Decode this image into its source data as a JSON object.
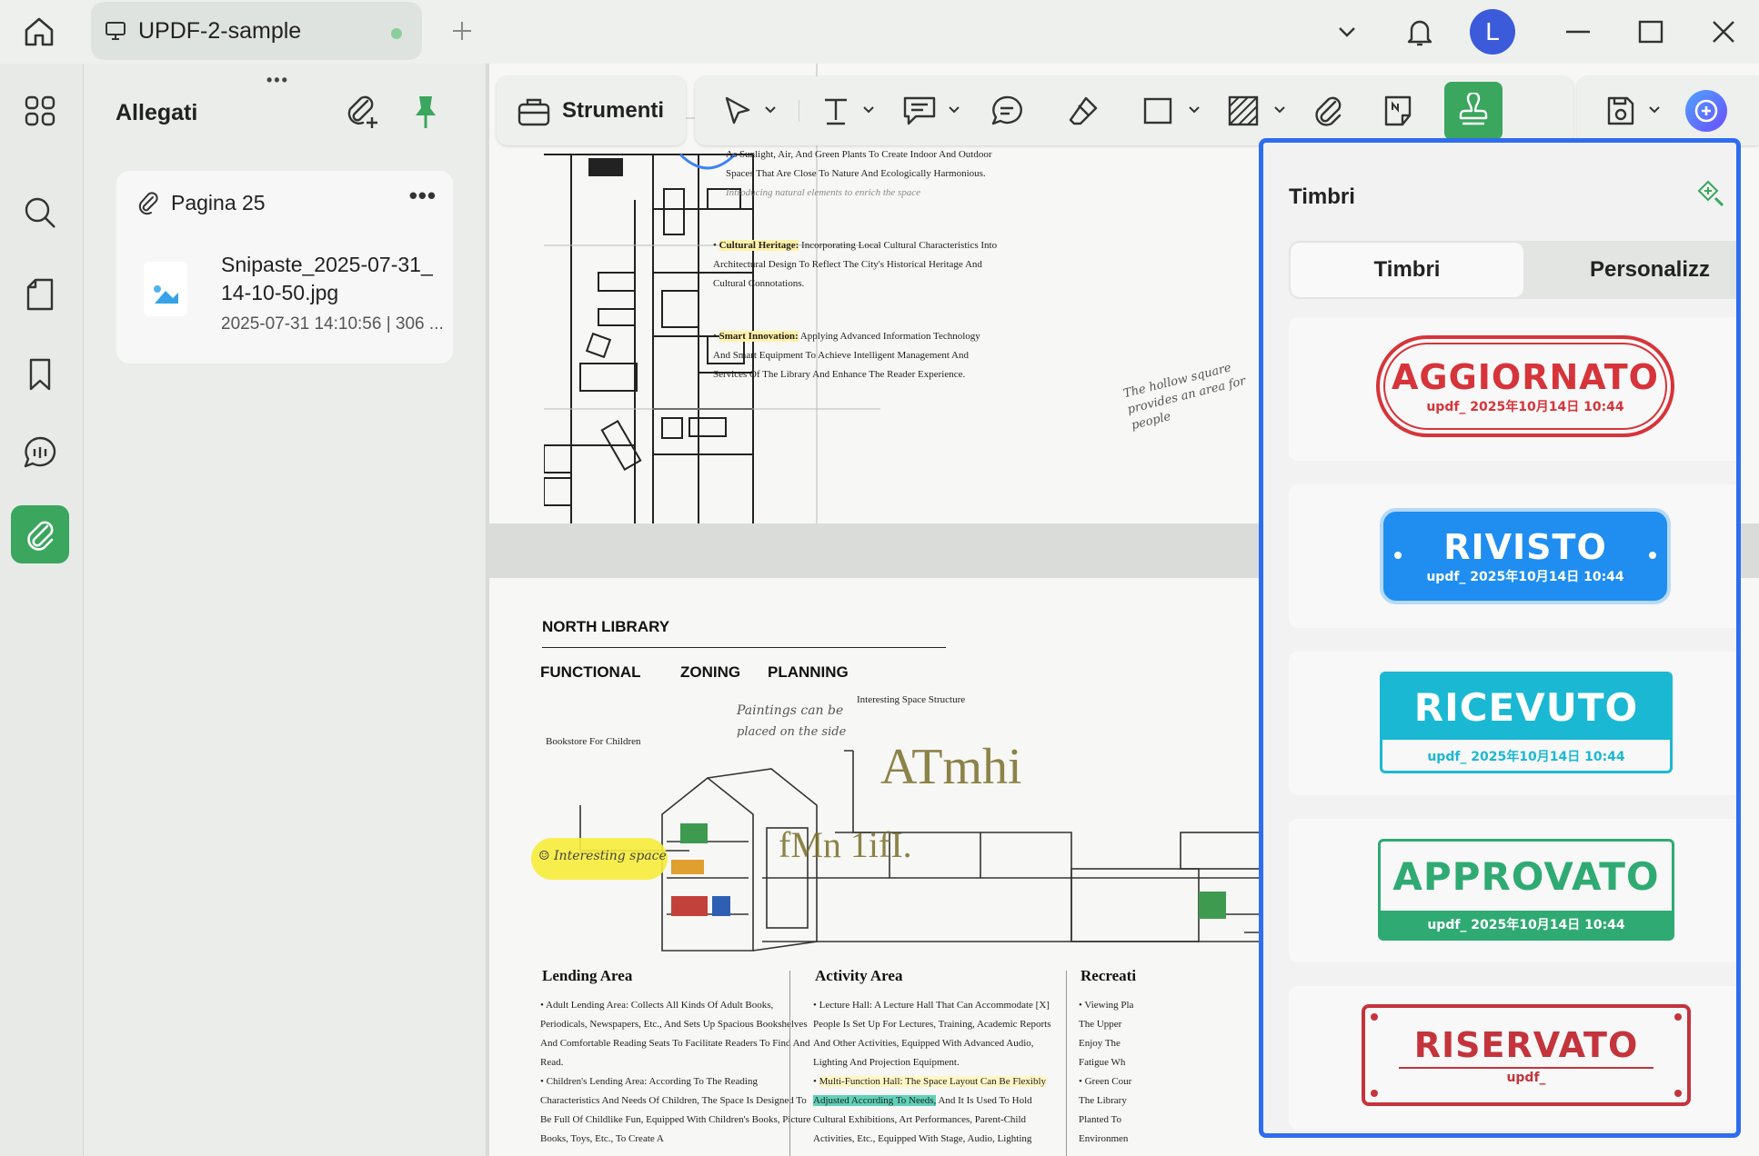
{
  "titlebar": {
    "tab_title": "UPDF-2-sample",
    "avatar_letter": "L"
  },
  "attachments": {
    "title": "Allegati",
    "page_label": "Pagina 25",
    "file_name": "Snipaste_2025-07-31_14-10-50.jpg",
    "file_meta": "2025-07-31 14:10:56 | 306 ..."
  },
  "toolbar": {
    "tools_label": "Strumenti"
  },
  "stamps": {
    "title": "Timbri",
    "tab_stamps": "Timbri",
    "tab_custom": "Personalizz",
    "items": [
      {
        "label": "AGGIORNATO",
        "sub": "updf_ 2025年10月14日 10:44",
        "color": "#d6343a"
      },
      {
        "label": "RIVISTO",
        "sub": "updf_ 2025年10月14日 10:44",
        "color": "#1f8ef0"
      },
      {
        "label": "RICEVUTO",
        "sub": "updf_ 2025年10月14日 10:44",
        "color": "#1bb8d3"
      },
      {
        "label": "APPROVATO",
        "sub": "updf_ 2025年10月14日 10:44",
        "color": "#2faa73"
      },
      {
        "label": "RISERVATO",
        "sub": "updf_",
        "color": "#c4343c"
      }
    ]
  },
  "document": {
    "page1": {
      "p_intro": "As Sunlight, Air, And Green Plants To Create Indoor And Outdoor Spaces That Are Close To Nature And Ecologically Harmonious.",
      "p_intro_note": "Introducing natural elements to enrich the space",
      "cultural_title": "Cultural Heritage:",
      "cultural_text": "Incorporating Local Cultural Characteristics Into Architectural Design To Reflect The City's Historical Heritage And Cultural Connotations.",
      "smart_title": "Smart Innovation:",
      "smart_text": "Applying Advanced Information Technology And Smart Equipment To Achieve Intelligent Management And Services Of The Library And Enhance The Reader Experience.",
      "handwriting": "The hollow square provides an area for people"
    },
    "page2": {
      "heading": "NORTH LIBRARY",
      "sub1": "FUNCTIONAL",
      "sub2": "ZONING",
      "sub3": "PLANNING",
      "label_bookstore": "Bookstore For Children",
      "label_structure": "Interesting Space Structure",
      "note_paintings_1": "Paintings can be",
      "note_paintings_2": "placed on the side",
      "note_interesting": "Interesting space",
      "ocr_1": "ATmhi",
      "ocr_2": "fMn 1ifI.",
      "lending_title": "Lending Area",
      "lending_1": "Adult Lending Area: Collects All Kinds Of Adult Books, Periodicals, Newspapers, Etc., And Sets Up Spacious Bookshelves And Comfortable Reading Seats To Facilitate Readers To Find And Read.",
      "lending_2": "Children's Lending Area: According To The Reading Characteristics And Needs Of Children, The Space Is Designed To Be Full Of Childlike Fun, Equipped With Children's Books, Picture Books, Toys, Etc., To Create A",
      "activity_title": "Activity Area",
      "activity_1": "Lecture Hall: A Lecture Hall That Can Accommodate [X] People Is Set Up For Lectures, Training, Academic Reports And Other Activities, Equipped With Advanced Audio, Lighting And Projection Equipment.",
      "activity_2a": "Multi-Function Hall: The Space Layout Can Be Flexibly",
      "activity_2b": "Adjusted According To Needs,",
      "activity_2c": "And It Is Used To Hold Cultural Exhibitions, Art Performances, Parent-Child Activities, Etc., Equipped With Stage, Audio, Lighting",
      "recreation_title": "Recreati",
      "recreation_1": "Viewing Pla The Upper Enjoy The Fatigue Wh",
      "recreation_2": "Green Cour The Library Planted To Environmen"
    }
  }
}
